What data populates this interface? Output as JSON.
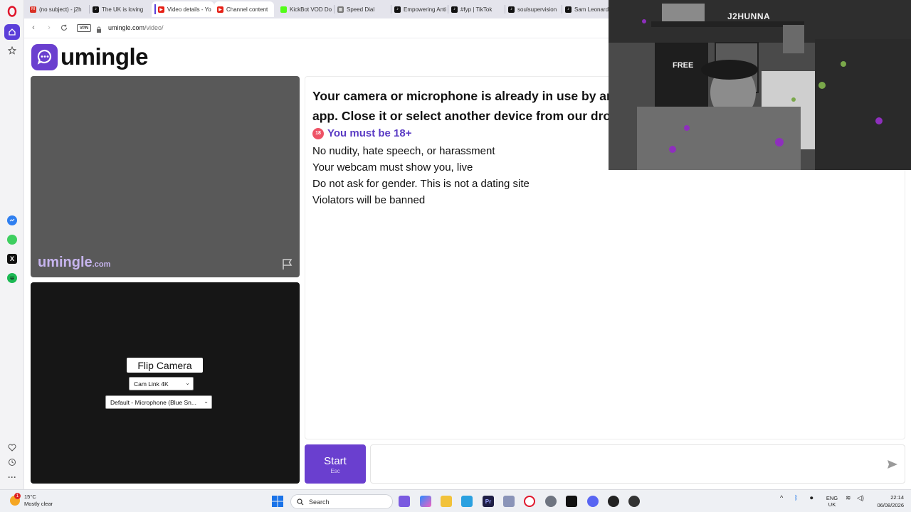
{
  "browser": {
    "tabs": [
      {
        "label": "(no subject) - j2h",
        "icon": "gmail-icon",
        "color": "#d93025"
      },
      {
        "label": "The UK is loving",
        "icon": "tiktok-icon",
        "color": "#111111"
      },
      {
        "label": "Video details - Yo",
        "icon": "youtube-studio-icon",
        "color": "#e62117"
      },
      {
        "label": "Channel content",
        "icon": "youtube-studio-icon",
        "color": "#e62117"
      },
      {
        "label": "KickBot VOD Do",
        "icon": "kickbot-icon",
        "color": "#53fc18"
      },
      {
        "label": "Speed Dial",
        "icon": "speed-dial-icon",
        "color": "#7a7a7a"
      },
      {
        "label": "Empowering Anti",
        "icon": "tiktok-icon",
        "color": "#111111"
      },
      {
        "label": "#fyp | TikTok",
        "icon": "tiktok-icon",
        "color": "#111111"
      },
      {
        "label": "soulsupervision",
        "icon": "tiktok-icon",
        "color": "#111111"
      },
      {
        "label": "Sam Leonard",
        "icon": "tiktok-icon",
        "color": "#111111"
      }
    ],
    "vpn_label": "VPN",
    "url_domain": "umingle.com",
    "url_path": "/video/"
  },
  "page": {
    "logo_text": "umingle",
    "brand_main": "umingle",
    "brand_suffix": ".com",
    "flip_camera_label": "Flip Camera",
    "camera_select": "Cam Link 4K",
    "mic_select": "Default - Microphone (Blue Sn...",
    "error_message": "Your camera or microphone is already in use by another app. Close it or select another device from our dropdown.",
    "age_badge": "18",
    "age_notice": "You must be 18+",
    "rules": [
      "No nudity, hate speech, or harassment",
      "Your webcam must show you, live",
      "Do not ask for gender. This is not a dating site",
      "Violators will be banned"
    ],
    "start_label": "Start",
    "start_hint": "Esc"
  },
  "overlay": {
    "webcam_caption": "J2HUNNA"
  },
  "taskbar": {
    "weather_temp": "15°C",
    "weather_desc": "Mostly clear",
    "weather_badge": "1",
    "search_placeholder": "Search",
    "lang_top": "ENG",
    "lang_bottom": "UK",
    "time": "22:14",
    "date": "06/08/2026"
  },
  "colors": {
    "accent": "#6a3fcf",
    "age_text": "#5a3bc4",
    "opera_red": "#e0162b"
  }
}
